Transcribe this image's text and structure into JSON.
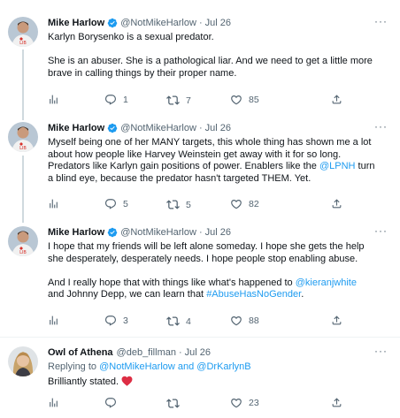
{
  "tweets": [
    {
      "name": "Mike Harlow",
      "handle": "@NotMikeHarlow",
      "date": "Jul 26",
      "lines": [
        "Karlyn Borysenko is a sexual predator."
      ],
      "lines2": [
        "She is an abuser. She is a pathological liar. And we need to get a little more",
        "brave in calling things by their proper name."
      ],
      "replies": "1",
      "retweets": "7",
      "likes": "85"
    },
    {
      "name": "Mike Harlow",
      "handle": "@NotMikeHarlow",
      "date": "Jul 26",
      "line1": "Myself being one of her MANY targets, this whole thing has shown me a lot",
      "line2": "about how people like Harvey Weinstein get away with it for so long.",
      "line3a": "Predators like Karlyn gain positions of power. Enablers like the ",
      "mention": "@LPNH",
      "line3b": " turn",
      "line4": "a blind eye, because the predator hasn't targeted THEM. Yet.",
      "replies": "5",
      "retweets": "5",
      "likes": "82"
    },
    {
      "name": "Mike Harlow",
      "handle": "@NotMikeHarlow",
      "date": "Jul 26",
      "line1": "I hope that my friends will be left alone someday. I hope she gets the help",
      "line2": "she desperately, desperately needs. I hope people stop enabling abuse.",
      "line3a": "And I really hope that with things like what's happened to ",
      "mention": "@kieranjwhite",
      "line4a": "and Johnny Depp, we can learn that ",
      "hashtag": "#AbuseHasNoGender",
      "line4b": ".",
      "replies": "3",
      "retweets": "4",
      "likes": "88"
    },
    {
      "name": "Owl of Athena",
      "handle": "@deb_fillman",
      "date": "Jul 26",
      "replying_prefix": "Replying to ",
      "replying_to": "@NotMikeHarlow and @DrKarlynB",
      "text": "Brilliantly stated.",
      "likes": "23"
    }
  ],
  "ui": {
    "separator": "·",
    "more": "···"
  },
  "colors": {
    "accent": "#1d9bf0",
    "heart": "#f91880",
    "muted": "#536471",
    "thread_line": "#cfd9de"
  }
}
